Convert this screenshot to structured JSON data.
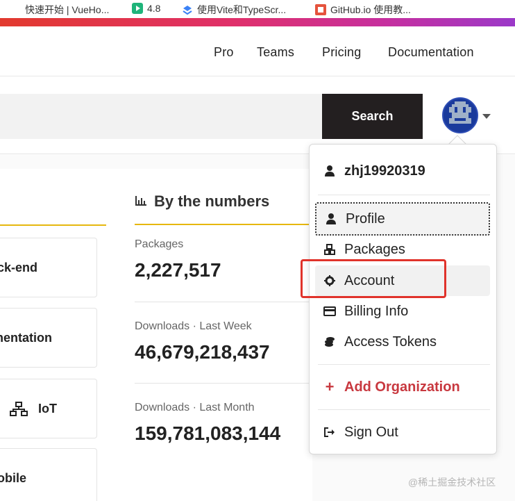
{
  "bookmarks": [
    {
      "label": "快速开始 | VueHo..."
    },
    {
      "label": "4.8"
    },
    {
      "label": "使用Vite和TypeScr..."
    },
    {
      "label": "GitHub.io 使用教..."
    }
  ],
  "nav": {
    "pro": "Pro",
    "teams": "Teams",
    "pricing": "Pricing",
    "documentation": "Documentation"
  },
  "search": {
    "placeholder": "",
    "button": "Search"
  },
  "left_cards": [
    "ck-end",
    "nentation",
    "IoT",
    "obile"
  ],
  "numbers": {
    "title": "By the numbers",
    "stats": [
      {
        "label": "Packages",
        "value": "2,227,517"
      },
      {
        "label": "Downloads · Last Week",
        "value": "46,679,218,437"
      },
      {
        "label": "Downloads · Last Month",
        "value": "159,781,083,144"
      }
    ]
  },
  "menu": {
    "username": "zhj19920319",
    "profile": "Profile",
    "packages": "Packages",
    "account": "Account",
    "billing": "Billing Info",
    "tokens": "Access Tokens",
    "add_org_plus": "+",
    "add_org": "Add Organization",
    "sign_out": "Sign Out"
  },
  "colors": {
    "accent_rule": "#e6b70e",
    "add_org": "#c8383f",
    "highlight": "#e0332b",
    "search_button": "#231f20"
  },
  "watermark": "@稀土掘金技术社区"
}
